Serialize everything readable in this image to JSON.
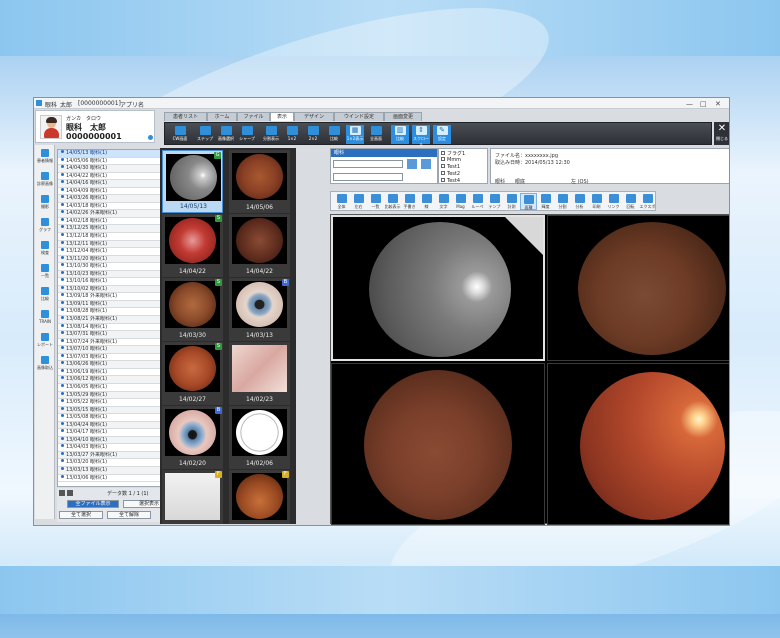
{
  "window": {
    "title_parts": [
      "眼科",
      "太郎",
      "[0000000001]",
      "アプリ名"
    ],
    "controls": [
      "—",
      "□",
      "✕"
    ]
  },
  "patient": {
    "kana": "ガンカ　タロウ",
    "name": "眼科　太郎",
    "id": "0000000001"
  },
  "tabs": [
    "患者リスト",
    "ホーム",
    "ファイル",
    "表示",
    "デザイン",
    "ウインド設定",
    "画面変更"
  ],
  "ribbon": [
    {
      "label": "CW画面"
    },
    {
      "label": "ステップ"
    },
    {
      "label": "画像選択"
    },
    {
      "label": "シャープ"
    },
    {
      "label": "分割表示"
    },
    {
      "label": "1×2"
    },
    {
      "label": "2×2"
    },
    {
      "label": "比較"
    },
    {
      "label": "1×2表示"
    },
    {
      "label": "全画面"
    },
    {
      "label": "比較"
    },
    {
      "label": "スクロール"
    },
    {
      "label": "設定"
    }
  ],
  "close_label": "閉じる",
  "left_nav": [
    "患者情報",
    "診察画像",
    "撮影",
    "グラフ",
    "検査",
    "一覧",
    "比較",
    "TRAIN",
    "レポート",
    "画像取込"
  ],
  "dates": [
    "14/05/13 眼科(1)",
    "14/05/06 眼科(1)",
    "14/04/30 眼科(1)",
    "14/04/22 眼科(1)",
    "14/04/16 眼科(1)",
    "14/04/09 眼科(1)",
    "14/03/26 眼科(1)",
    "14/03/18 眼科(1)",
    "14/02/26 外来眼科(1)",
    "14/02/18 眼科(1)",
    "13/12/25 眼科(1)",
    "13/12/18 眼科(1)",
    "13/12/11 眼科(1)",
    "13/12/04 眼科(1)",
    "13/11/20 眼科(1)",
    "13/10/30 眼科(1)",
    "13/10/23 眼科(1)",
    "13/10/16 眼科(1)",
    "13/10/02 眼科(1)",
    "13/09/18 外来眼科(1)",
    "13/09/11 眼科(1)",
    "13/08/28 眼科(1)",
    "13/08/21 外来眼科(1)",
    "13/08/14 眼科(1)",
    "13/07/31 眼科(1)",
    "13/07/24 外来眼科(1)",
    "13/07/10 眼科(1)",
    "13/07/03 眼科(1)",
    "13/06/26 眼科(1)",
    "13/06/19 眼科(1)",
    "13/06/12 眼科(1)",
    "13/06/05 眼科(1)",
    "13/05/29 眼科(1)",
    "13/05/22 眼科(1)",
    "13/05/15 眼科(1)",
    "13/05/08 眼科(1)",
    "13/04/24 眼科(1)",
    "13/04/17 眼科(1)",
    "13/04/10 眼科(1)",
    "13/04/03 眼科(1)",
    "13/03/27 外来眼科(1)",
    "13/03/20 眼科(1)",
    "13/03/13 眼科(1)",
    "13/03/06 眼科(1)"
  ],
  "bottom_left": {
    "count_label": "データ数 1 / 1 (1)",
    "btn_a": "全ファイル表示",
    "btn_b": "選択表示",
    "btn_c": "全て選択",
    "btn_d": "全て解除"
  },
  "thumbs": [
    {
      "date": "14/05/13",
      "badge": "G"
    },
    {
      "date": "14/05/06",
      "badge": ""
    },
    {
      "date": "14/04/22",
      "badge": "S"
    },
    {
      "date": "14/04/22",
      "badge": ""
    },
    {
      "date": "14/03/30",
      "badge": "S"
    },
    {
      "date": "14/03/13",
      "badge": "B"
    },
    {
      "date": "14/02/27",
      "badge": "S"
    },
    {
      "date": "14/02/23",
      "badge": ""
    },
    {
      "date": "14/02/20",
      "badge": "B"
    },
    {
      "date": "14/02/06",
      "badge": ""
    },
    {
      "date": "",
      "badge": "F"
    },
    {
      "date": "",
      "badge": "F"
    }
  ],
  "patient_panel": {
    "header": "眼科",
    "checks": [
      "フラグ1",
      "Mmm",
      "Test1",
      "Test2",
      "Test4"
    ],
    "file": "ファイル名：xxxxxxxx.jpg",
    "date": "取込み日時：2014/05/13 12:30",
    "dept_label": "眼科",
    "dept_value": "眼底",
    "eye": "左 (OS)"
  },
  "view_tools": [
    {
      "label": "全体"
    },
    {
      "label": "左右"
    },
    {
      "label": "一覧"
    },
    {
      "label": "比較表示"
    },
    {
      "label": "手書き"
    },
    {
      "label": "線"
    },
    {
      "label": "文字"
    },
    {
      "label": "Mag"
    },
    {
      "label": "ルーペ"
    },
    {
      "label": "テンプ"
    },
    {
      "label": "計測"
    },
    {
      "label": "面積"
    },
    {
      "label": "輝度"
    },
    {
      "label": "分割"
    },
    {
      "label": "分析"
    },
    {
      "label": "印刷"
    },
    {
      "label": "リンク"
    },
    {
      "label": "回転"
    },
    {
      "label": "エクスポ"
    }
  ]
}
